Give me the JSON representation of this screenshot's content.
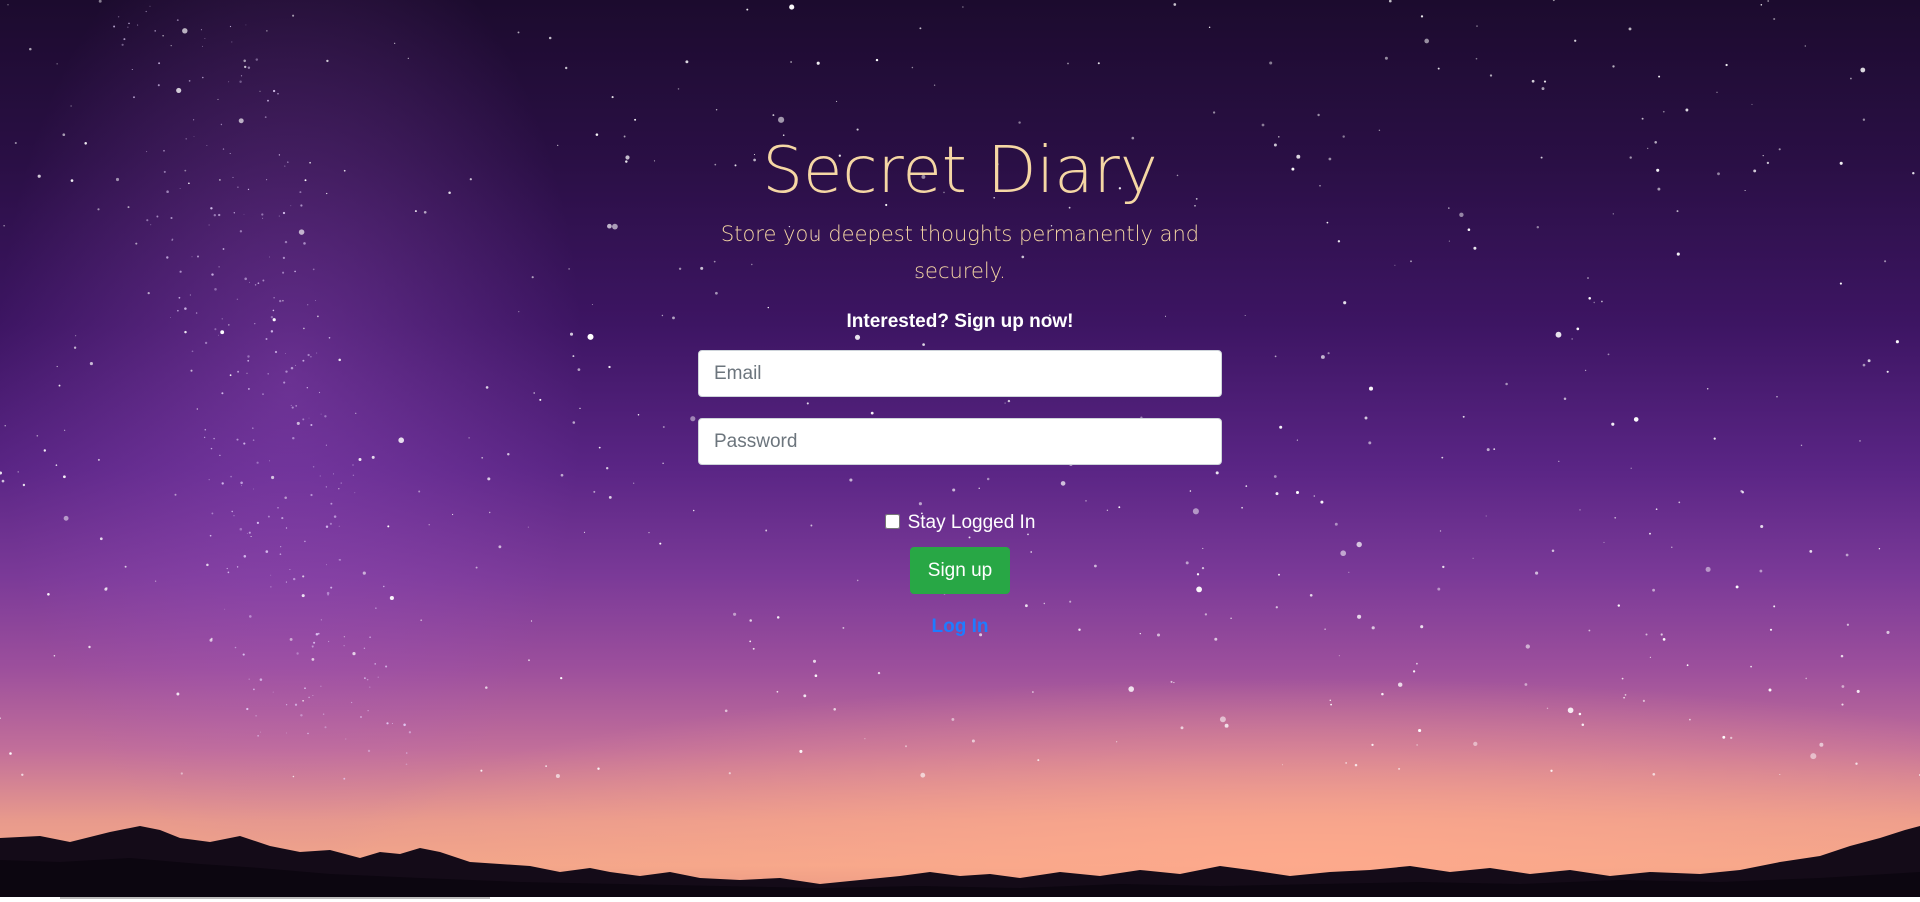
{
  "header": {
    "title": "Secret Diary",
    "subtitle": "Store you deepest thoughts permanently and securely."
  },
  "form": {
    "call_to_action": "Interested? Sign up now!",
    "email_placeholder": "Email",
    "password_placeholder": "Password",
    "stay_logged_in_label": "Stay Logged In",
    "stay_logged_in_checked": false,
    "signup_label": "Sign up",
    "login_link_label": "Log In"
  },
  "colors": {
    "title": "#f5d7a4",
    "signup_button": "#28a745",
    "login_link": "#1f7bff"
  }
}
